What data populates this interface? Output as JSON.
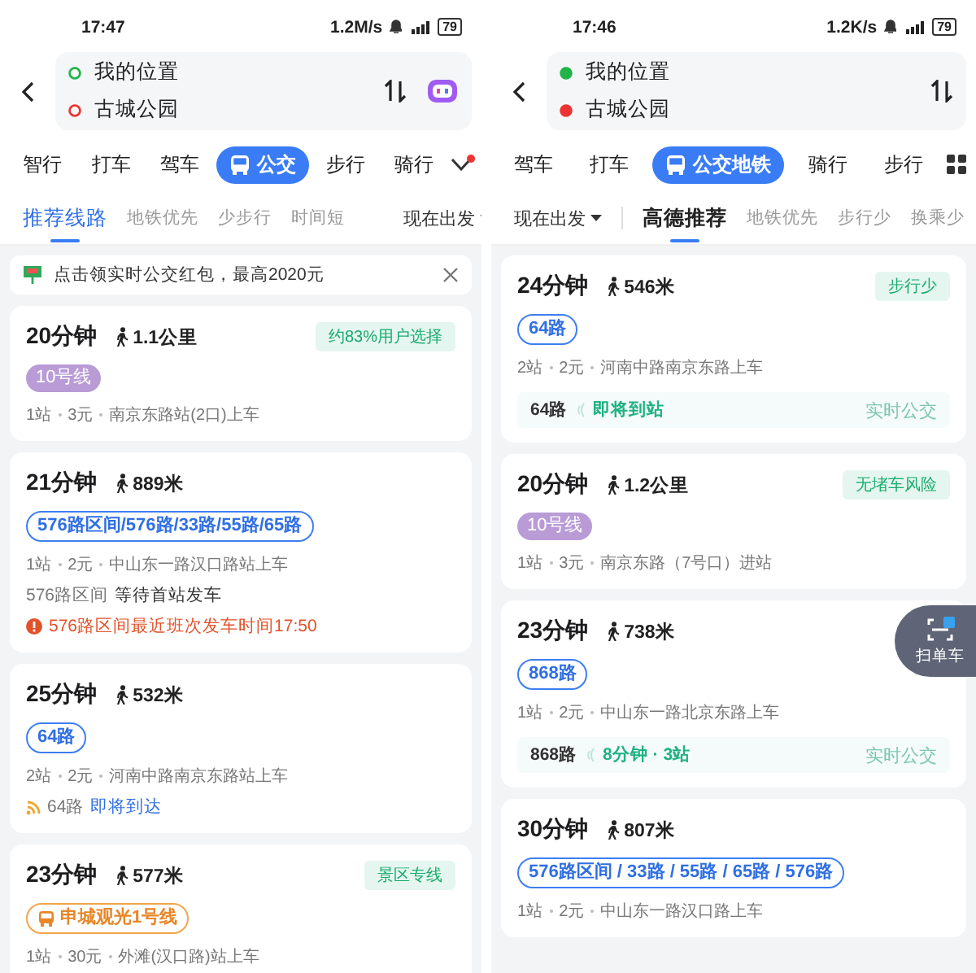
{
  "screens": [
    {
      "status": {
        "time": "17:47",
        "speed": "1.2M/s",
        "battery": "79"
      },
      "route": {
        "from": "我的位置",
        "to": "古城公园",
        "assistant_icon": true
      },
      "modes": [
        {
          "label": "智行",
          "selected": false
        },
        {
          "label": "打车",
          "selected": false
        },
        {
          "label": "驾车",
          "selected": false
        },
        {
          "label": "公交",
          "selected": true
        },
        {
          "label": "步行",
          "selected": false
        },
        {
          "label": "骑行",
          "selected": false
        }
      ],
      "more": {
        "kind": "chevron",
        "dot": true
      },
      "depart": {
        "label": "现在出发",
        "first": false
      },
      "bold_selected_sort": false,
      "sorts": [
        {
          "label": "推荐线路",
          "selected": true
        },
        {
          "label": "地铁优先",
          "selected": false
        },
        {
          "label": "少步行",
          "selected": false
        },
        {
          "label": "时间短",
          "selected": false
        }
      ],
      "banner": {
        "text": "点击领实时公交红包，最高2020元"
      },
      "routes": [
        {
          "duration": "20分钟",
          "walk": "1.1公里",
          "badge": "约83%用户选择",
          "lines": [
            {
              "text": "10号线",
              "kind": "metro"
            }
          ],
          "info": [
            "1站",
            "3元",
            "南京东路站(2口)上车"
          ]
        },
        {
          "duration": "21分钟",
          "walk": "889米",
          "lines": [
            {
              "text": "576路区间/576路/33路/55路/65路",
              "kind": "bus"
            }
          ],
          "info": [
            "1站",
            "2元",
            "中山东一路汉口路站上车"
          ],
          "wait": {
            "line": "576路区间",
            "status": "等待首站发车"
          },
          "alert": "576路区间最近班次发车时间17:50"
        },
        {
          "duration": "25分钟",
          "walk": "532米",
          "lines": [
            {
              "text": "64路",
              "kind": "bus"
            }
          ],
          "info": [
            "2站",
            "2元",
            "河南中路南京东路站上车"
          ],
          "live": {
            "kind": "inline",
            "line": "64路",
            "status": "即将到达"
          }
        },
        {
          "duration": "23分钟",
          "walk": "577米",
          "badge": "景区专线",
          "lines": [
            {
              "text": "申城观光1号线",
              "kind": "tour"
            }
          ],
          "info": [
            "1站",
            "30元",
            "外滩(汉口路)站上车"
          ]
        }
      ]
    },
    {
      "status": {
        "time": "17:46",
        "speed": "1.2K/s",
        "battery": "79"
      },
      "route": {
        "from": "我的位置",
        "to": "古城公园",
        "assistant_icon": false
      },
      "modes": [
        {
          "label": "驾车",
          "selected": false
        },
        {
          "label": "打车",
          "selected": false
        },
        {
          "label": "公交地铁",
          "selected": true
        },
        {
          "label": "骑行",
          "selected": false
        },
        {
          "label": "步行",
          "selected": false
        }
      ],
      "more": {
        "kind": "grid",
        "dot": false
      },
      "depart": {
        "label": "现在出发",
        "first": true
      },
      "bold_selected_sort": true,
      "sorts": [
        {
          "label": "高德推荐",
          "selected": true
        },
        {
          "label": "地铁优先",
          "selected": false
        },
        {
          "label": "步行少",
          "selected": false
        },
        {
          "label": "换乘少",
          "selected": false
        }
      ],
      "routes": [
        {
          "duration": "24分钟",
          "walk": "546米",
          "badge": "步行少",
          "lines": [
            {
              "text": "64路",
              "kind": "bus"
            }
          ],
          "info": [
            "2站",
            "2元",
            "河南中路南京东路上车"
          ],
          "live": {
            "kind": "box",
            "line": "64路",
            "status": "即将到站",
            "action": "实时公交"
          }
        },
        {
          "duration": "20分钟",
          "walk": "1.2公里",
          "badge": "无堵车风险",
          "lines": [
            {
              "text": "10号线",
              "kind": "metro"
            }
          ],
          "info": [
            "1站",
            "3元",
            "南京东路（7号口）进站"
          ]
        },
        {
          "duration": "23分钟",
          "walk": "738米",
          "lines": [
            {
              "text": "868路",
              "kind": "bus"
            }
          ],
          "info": [
            "1站",
            "2元",
            "中山东一路北京东路上车"
          ],
          "live": {
            "kind": "box",
            "line": "868路",
            "status": "8分钟 · 3站",
            "action": "实时公交"
          }
        },
        {
          "duration": "30分钟",
          "walk": "807米",
          "lines": [
            {
              "text": "576路区间 / 33路 / 55路 / 65路 / 576路",
              "kind": "bus"
            }
          ],
          "info": [
            "1站",
            "2元",
            "中山东一路汉口路上车"
          ]
        }
      ],
      "scan_button": {
        "label": "扫单车"
      }
    }
  ]
}
